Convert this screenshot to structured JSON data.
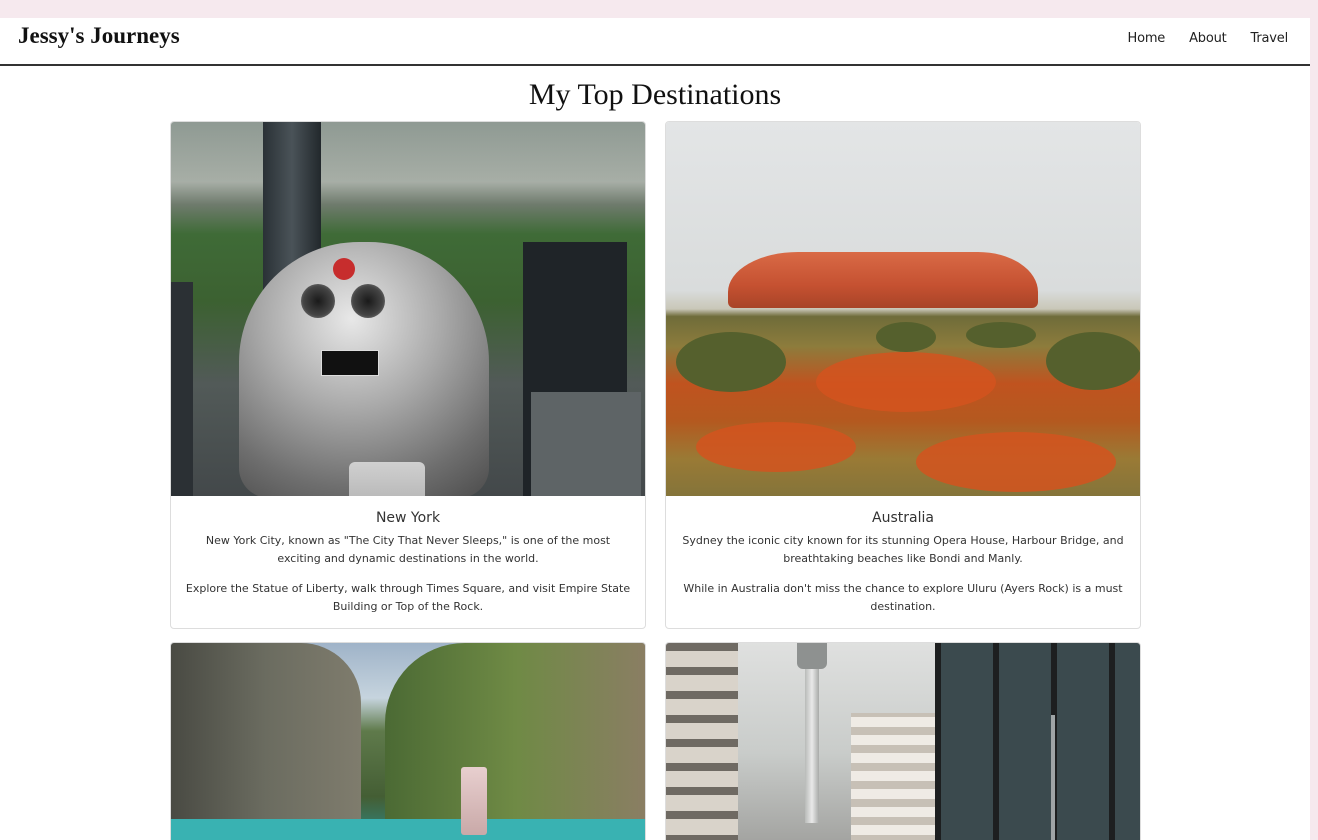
{
  "brand": "Jessy's Journeys",
  "nav": {
    "items": [
      {
        "label": "Home"
      },
      {
        "label": "About"
      },
      {
        "label": "Travel"
      }
    ]
  },
  "page_title": "My Top Destinations",
  "cards": [
    {
      "title": "New York",
      "text1": "New York City, known as \"The City That Never Sleeps,\" is one of the most exciting and dynamic destinations in the world.",
      "text2": "Explore the Statue of Liberty, walk through Times Square, and visit Empire State Building or Top of the Rock."
    },
    {
      "title": "Australia",
      "text1": "Sydney the iconic city known for its stunning Opera House, Harbour Bridge, and breathtaking beaches like Bondi and Manly.",
      "text2": "While in Australia don't miss the chance to explore Uluru (Ayers Rock) is a must destination."
    }
  ],
  "colors": {
    "background_outer": "#f6e9ee",
    "navbar_border": "#333333",
    "text": "#333333"
  }
}
